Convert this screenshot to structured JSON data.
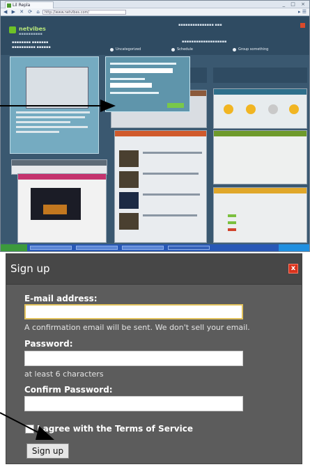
{
  "browser": {
    "tab_title": "Lil Repla",
    "url": "http://www.netvibes.com/",
    "site_logo_text": "netvibes",
    "site_tabs": [
      "Uncategorized",
      "Schedule",
      "Group something"
    ]
  },
  "dialog": {
    "title": "Sign up",
    "close_label": "x",
    "email_label": "E-mail address:",
    "email_value": "",
    "email_hint": "A confirmation email will be sent. We don't sell your email.",
    "password_label": "Password:",
    "password_value": "",
    "password_hint": "at least 6 characters",
    "confirm_label": "Confirm Password:",
    "confirm_value": "",
    "terms_label": "I agree with the Terms of Service",
    "terms_checked": false,
    "submit_label": "Sign up"
  },
  "colors": {
    "dialog_bg": "#5c5c5c",
    "dialog_header": "#474747",
    "close_red": "#d9331d",
    "email_focus": "#e2c25c"
  },
  "icons": {
    "close": "close-icon",
    "arrow_top": "arrow-pointer-icon",
    "arrow_bottom": "arrow-pointer-icon"
  }
}
